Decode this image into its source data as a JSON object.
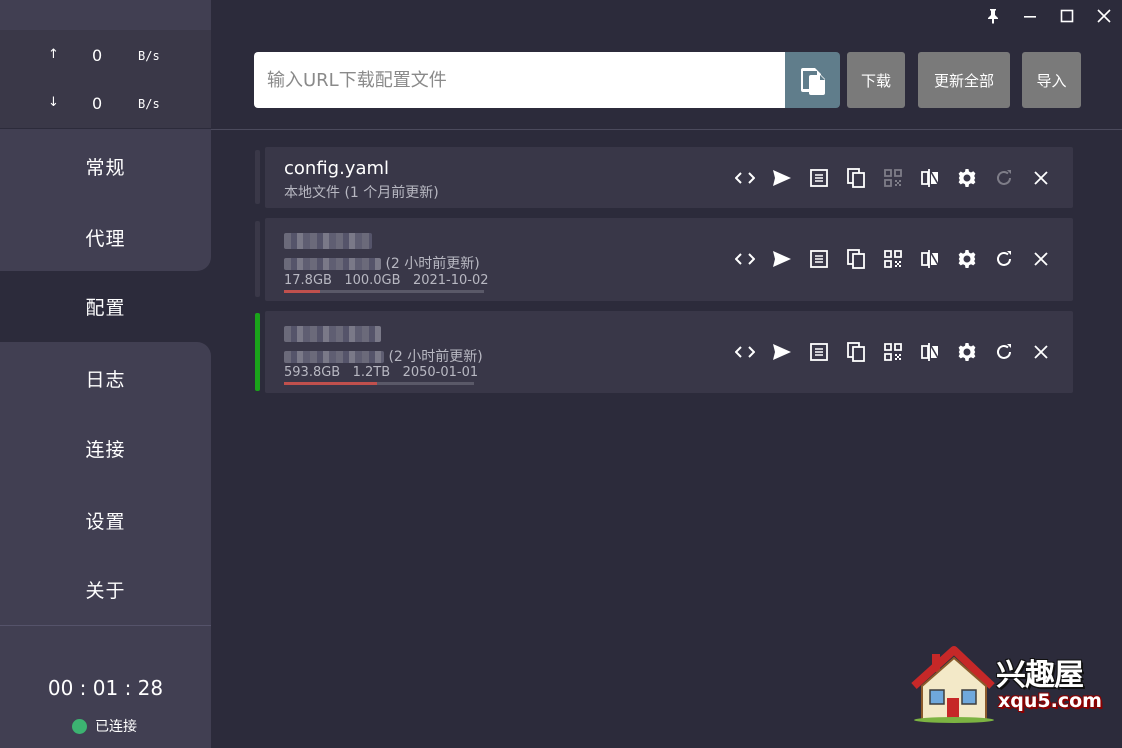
{
  "window": {
    "controls": [
      "pin-icon",
      "minimize-icon",
      "maximize-icon",
      "close-icon"
    ]
  },
  "traffic": {
    "up_arrow": "↑",
    "up_value": "0",
    "up_unit": "B/s",
    "down_arrow": "↓",
    "down_value": "0",
    "down_unit": "B/s"
  },
  "nav": {
    "items": [
      {
        "label": "常规"
      },
      {
        "label": "代理"
      },
      {
        "label": "配置",
        "active": true
      },
      {
        "label": "日志"
      },
      {
        "label": "连接"
      },
      {
        "label": "设置"
      },
      {
        "label": "关于"
      }
    ]
  },
  "status": {
    "timer": "00 : 01 : 28",
    "connection": "已连接"
  },
  "toolbar": {
    "url_placeholder": "输入URL下载配置文件",
    "url_value": "",
    "download_label": "下载",
    "update_all_label": "更新全部",
    "import_label": "导入"
  },
  "profiles": [
    {
      "name": "config.yaml",
      "subtitle": "本地文件 (1 个月前更新)",
      "active": false,
      "has_usage": false,
      "qr_enabled": false,
      "refresh_enabled": false
    },
    {
      "name": "",
      "subtitle_suffix": "(2 小时前更新)",
      "active": false,
      "has_usage": true,
      "used": "17.8GB",
      "total": "100.0GB",
      "expires": "2021-10-02",
      "usage_fraction": 0.178,
      "qr_enabled": true,
      "refresh_enabled": true
    },
    {
      "name": "",
      "subtitle_suffix": "(2 小时前更新)",
      "active": true,
      "has_usage": true,
      "used": "593.8GB",
      "total": "1.2TB",
      "expires": "2050-01-01",
      "usage_fraction": 0.49,
      "qr_enabled": true,
      "refresh_enabled": true
    }
  ],
  "watermark": {
    "title": "兴趣屋",
    "domain": "xqu5.com"
  },
  "colors": {
    "background": "#2c2b3b",
    "sidebar": "#413f52",
    "card": "#393748",
    "active_indicator": "#1aa31a",
    "connected": "#3cb371",
    "usage_fill": "#c0504d",
    "button": "#7a7a7a",
    "paste_button": "#607d8b"
  }
}
